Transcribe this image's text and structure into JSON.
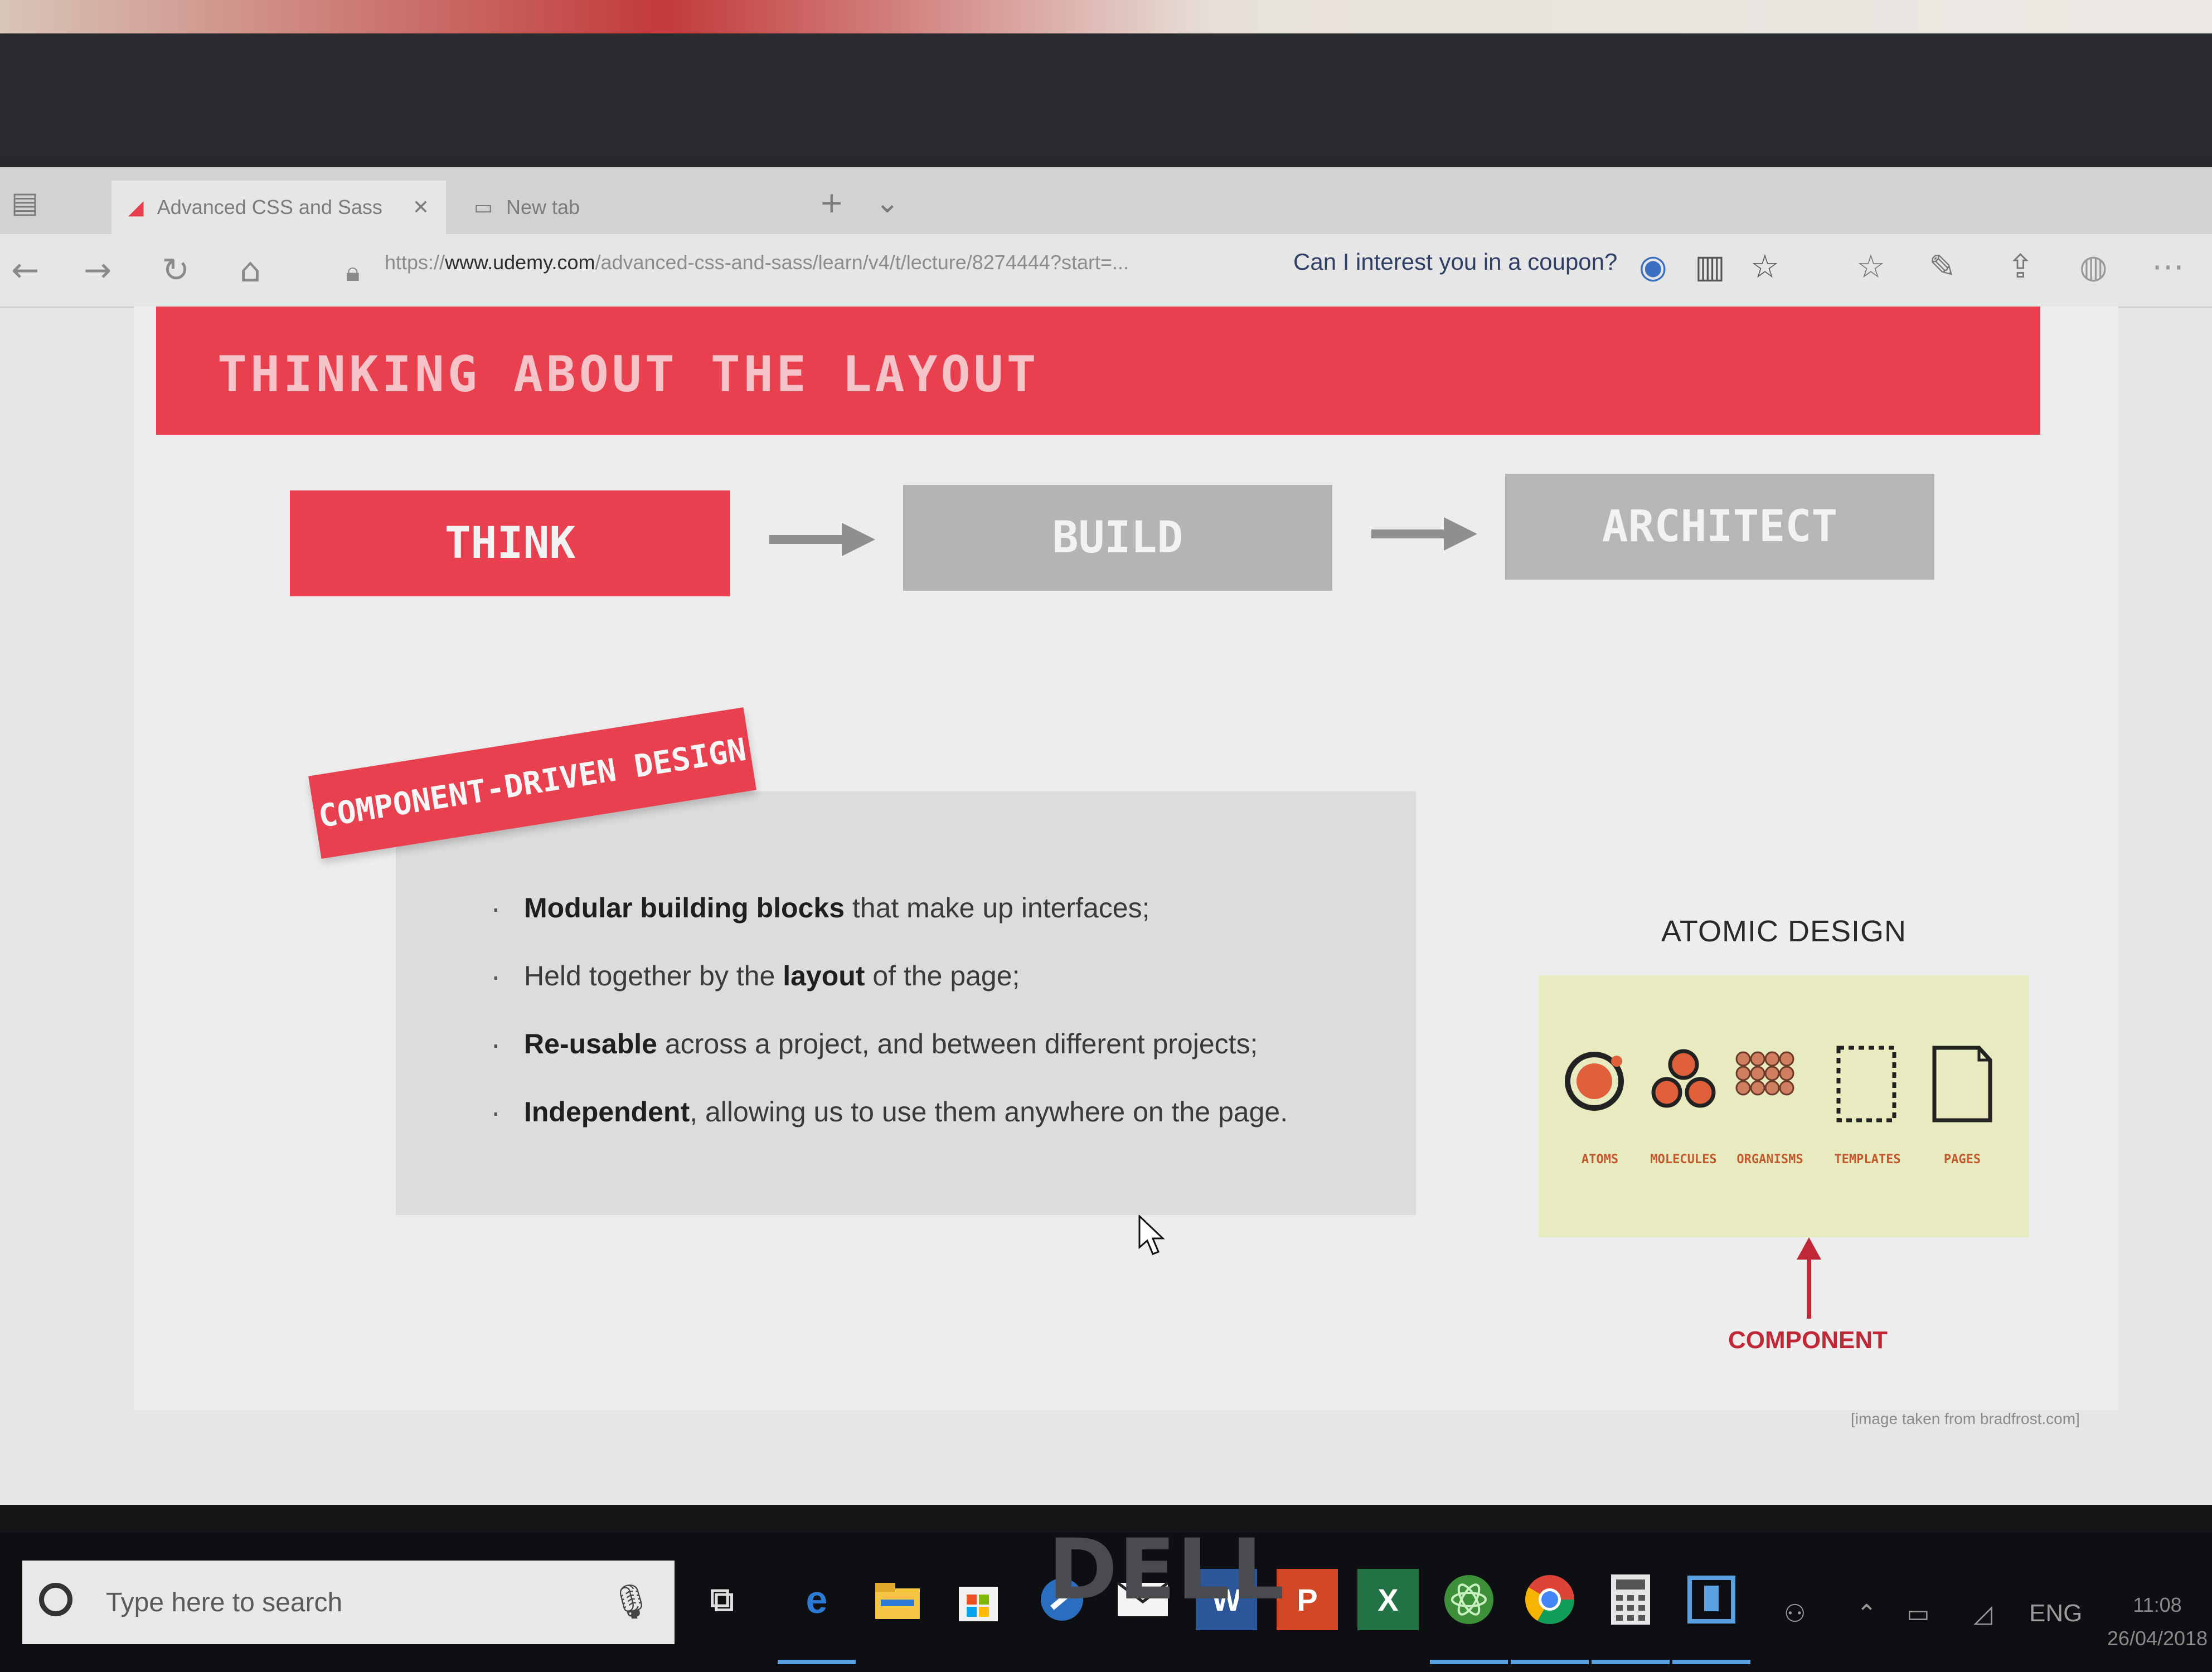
{
  "browser": {
    "tabs": [
      {
        "label": "Advanced CSS and Sass",
        "active": true
      },
      {
        "label": "New tab",
        "active": false
      }
    ],
    "url": {
      "prefix": "https://",
      "host": "www.udemy.com",
      "path": "/advanced-css-and-sass/learn/v4/t/lecture/8274444?start=..."
    },
    "coupon_text": "Can I interest you in a coupon?"
  },
  "slide": {
    "title": "THINKING ABOUT THE LAYOUT",
    "steps": [
      "THINK",
      "BUILD",
      "ARCHITECT"
    ],
    "section_label": "COMPONENT-DRIVEN DESIGN",
    "bullets": [
      {
        "bold": "Modular building blocks",
        "rest": " that make up interfaces;"
      },
      {
        "pre": "Held together by the ",
        "bold": "layout",
        "rest": " of the page;"
      },
      {
        "bold": "Re-usable",
        "rest": " across a project, and between different projects;"
      },
      {
        "bold": "Independent",
        "rest": ", allowing us to use them anywhere on the page."
      }
    ],
    "atomic": {
      "title": "ATOMIC DESIGN",
      "stages": [
        "ATOMS",
        "MOLECULES",
        "ORGANISMS",
        "TEMPLATES",
        "PAGES"
      ],
      "pointer_label": "COMPONENT"
    },
    "credit": "[image taken from bradfrost.com]"
  },
  "taskbar": {
    "search_placeholder": "Type here to search",
    "apps": [
      "task-view",
      "edge",
      "file-explorer",
      "store",
      "settings-tool",
      "mail",
      "word",
      "powerpoint",
      "excel",
      "atom",
      "chrome",
      "calculator",
      "window-app"
    ],
    "tray": {
      "language": "ENG",
      "time": "11:08",
      "date": "26/04/2018"
    }
  },
  "brand": "DELL",
  "colors": {
    "accent": "#e8404f",
    "box_gray": "#b4b4b4",
    "atomic_panel": "#e8ebc0",
    "component": "#c02838"
  }
}
